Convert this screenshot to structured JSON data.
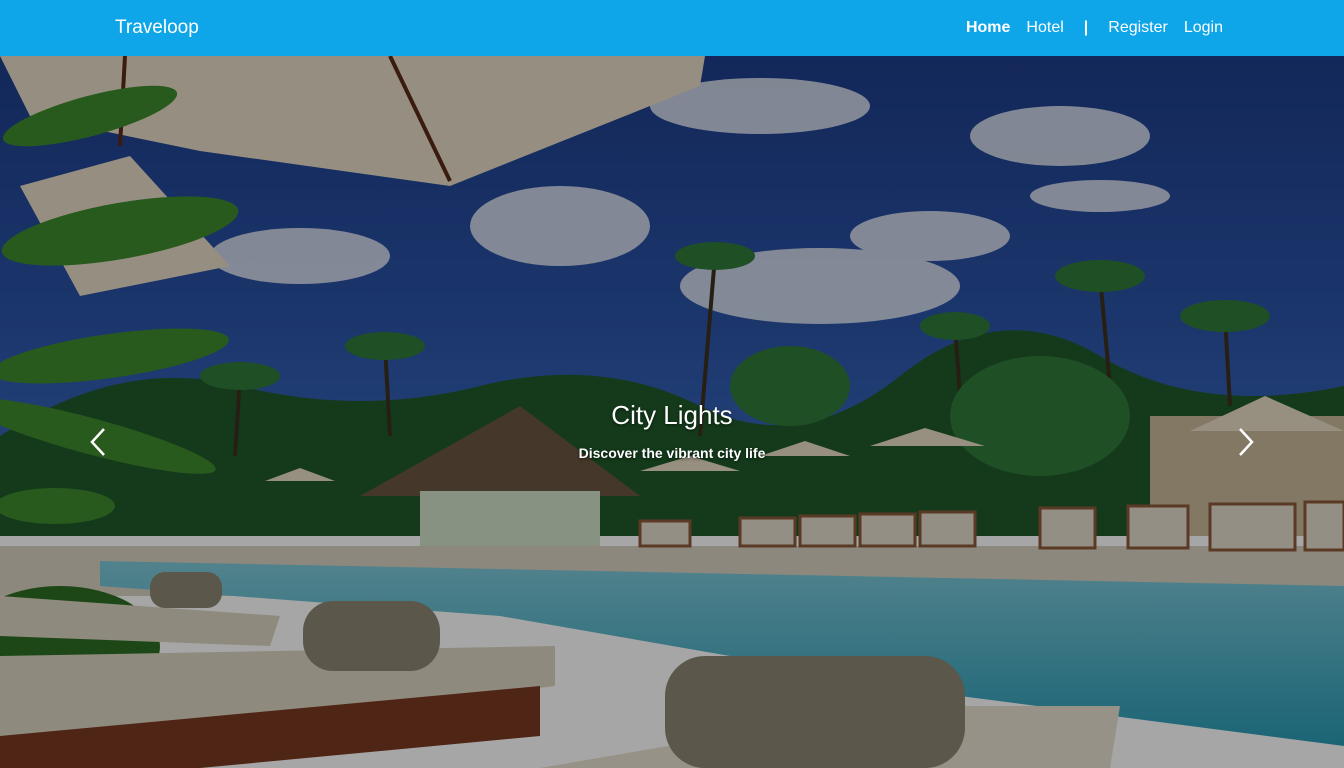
{
  "navbar": {
    "brand": "Traveloop",
    "links": {
      "home": "Home",
      "hotel": "Hotel",
      "separator": "|",
      "register": "Register",
      "login": "Login"
    }
  },
  "carousel": {
    "title": "City Lights",
    "subtitle": "Discover the vibrant city life"
  },
  "colors": {
    "navbar_bg": "#0ea5e9",
    "text": "#ffffff"
  },
  "icons": {
    "prev": "chevron-left-icon",
    "next": "chevron-right-icon"
  }
}
